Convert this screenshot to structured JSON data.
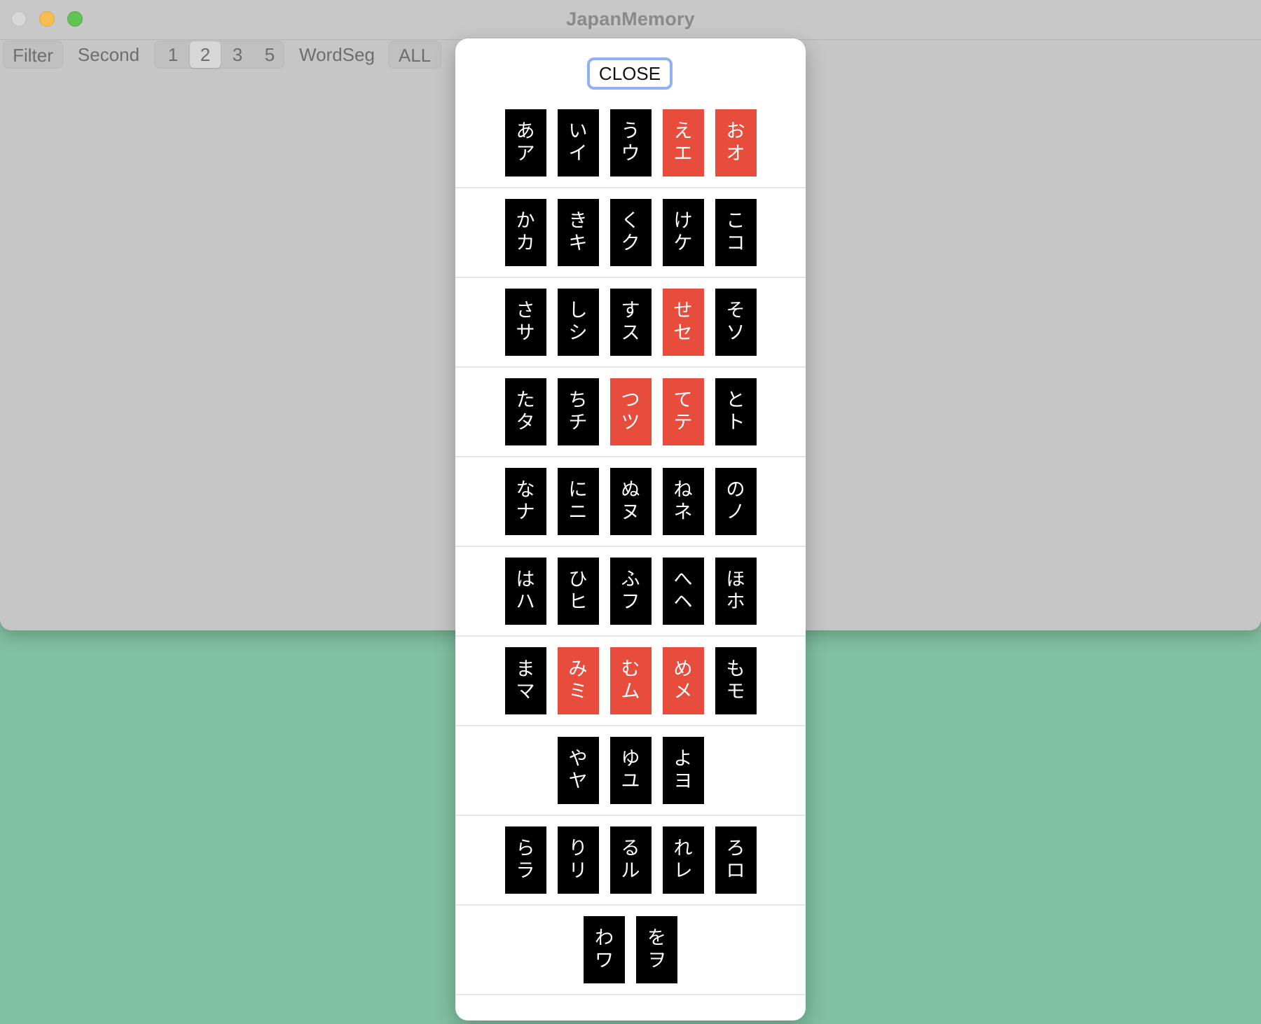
{
  "app": {
    "title": "JapanMemory"
  },
  "toolbar": {
    "filter_label": "Filter",
    "second_label": "Second",
    "segments": [
      "1",
      "2",
      "3",
      "5"
    ],
    "selected_segment": "2",
    "wordseg_label": "WordSeg",
    "all_label": "ALL"
  },
  "popover": {
    "close_label": "CLOSE",
    "marked_color": "#e84c3d",
    "default_color": "#000000",
    "rows": [
      {
        "name": "a",
        "cards": [
          {
            "hiragana": "あ",
            "katakana": "ア",
            "marked": false
          },
          {
            "hiragana": "い",
            "katakana": "イ",
            "marked": false
          },
          {
            "hiragana": "う",
            "katakana": "ウ",
            "marked": false
          },
          {
            "hiragana": "え",
            "katakana": "エ",
            "marked": true
          },
          {
            "hiragana": "お",
            "katakana": "オ",
            "marked": true
          }
        ]
      },
      {
        "name": "ka",
        "cards": [
          {
            "hiragana": "か",
            "katakana": "カ",
            "marked": false
          },
          {
            "hiragana": "き",
            "katakana": "キ",
            "marked": false
          },
          {
            "hiragana": "く",
            "katakana": "ク",
            "marked": false
          },
          {
            "hiragana": "け",
            "katakana": "ケ",
            "marked": false
          },
          {
            "hiragana": "こ",
            "katakana": "コ",
            "marked": false
          }
        ]
      },
      {
        "name": "sa",
        "cards": [
          {
            "hiragana": "さ",
            "katakana": "サ",
            "marked": false
          },
          {
            "hiragana": "し",
            "katakana": "シ",
            "marked": false
          },
          {
            "hiragana": "す",
            "katakana": "ス",
            "marked": false
          },
          {
            "hiragana": "せ",
            "katakana": "セ",
            "marked": true
          },
          {
            "hiragana": "そ",
            "katakana": "ソ",
            "marked": false
          }
        ]
      },
      {
        "name": "ta",
        "cards": [
          {
            "hiragana": "た",
            "katakana": "タ",
            "marked": false
          },
          {
            "hiragana": "ち",
            "katakana": "チ",
            "marked": false
          },
          {
            "hiragana": "つ",
            "katakana": "ツ",
            "marked": true
          },
          {
            "hiragana": "て",
            "katakana": "テ",
            "marked": true
          },
          {
            "hiragana": "と",
            "katakana": "ト",
            "marked": false
          }
        ]
      },
      {
        "name": "na",
        "cards": [
          {
            "hiragana": "な",
            "katakana": "ナ",
            "marked": false
          },
          {
            "hiragana": "に",
            "katakana": "ニ",
            "marked": false
          },
          {
            "hiragana": "ぬ",
            "katakana": "ヌ",
            "marked": false
          },
          {
            "hiragana": "ね",
            "katakana": "ネ",
            "marked": false
          },
          {
            "hiragana": "の",
            "katakana": "ノ",
            "marked": false
          }
        ]
      },
      {
        "name": "ha",
        "cards": [
          {
            "hiragana": "は",
            "katakana": "ハ",
            "marked": false
          },
          {
            "hiragana": "ひ",
            "katakana": "ヒ",
            "marked": false
          },
          {
            "hiragana": "ふ",
            "katakana": "フ",
            "marked": false
          },
          {
            "hiragana": "へ",
            "katakana": "ヘ",
            "marked": false
          },
          {
            "hiragana": "ほ",
            "katakana": "ホ",
            "marked": false
          }
        ]
      },
      {
        "name": "ma",
        "cards": [
          {
            "hiragana": "ま",
            "katakana": "マ",
            "marked": false
          },
          {
            "hiragana": "み",
            "katakana": "ミ",
            "marked": true
          },
          {
            "hiragana": "む",
            "katakana": "ム",
            "marked": true
          },
          {
            "hiragana": "め",
            "katakana": "メ",
            "marked": true
          },
          {
            "hiragana": "も",
            "katakana": "モ",
            "marked": false
          }
        ]
      },
      {
        "name": "ya",
        "cards": [
          {
            "hiragana": "や",
            "katakana": "ヤ",
            "marked": false
          },
          {
            "hiragana": "ゆ",
            "katakana": "ユ",
            "marked": false
          },
          {
            "hiragana": "よ",
            "katakana": "ヨ",
            "marked": false
          }
        ]
      },
      {
        "name": "ra",
        "cards": [
          {
            "hiragana": "ら",
            "katakana": "ラ",
            "marked": false
          },
          {
            "hiragana": "り",
            "katakana": "リ",
            "marked": false
          },
          {
            "hiragana": "る",
            "katakana": "ル",
            "marked": false
          },
          {
            "hiragana": "れ",
            "katakana": "レ",
            "marked": false
          },
          {
            "hiragana": "ろ",
            "katakana": "ロ",
            "marked": false
          }
        ]
      },
      {
        "name": "wa",
        "cards": [
          {
            "hiragana": "わ",
            "katakana": "ワ",
            "marked": false
          },
          {
            "hiragana": "を",
            "katakana": "ヲ",
            "marked": false
          }
        ]
      }
    ]
  }
}
